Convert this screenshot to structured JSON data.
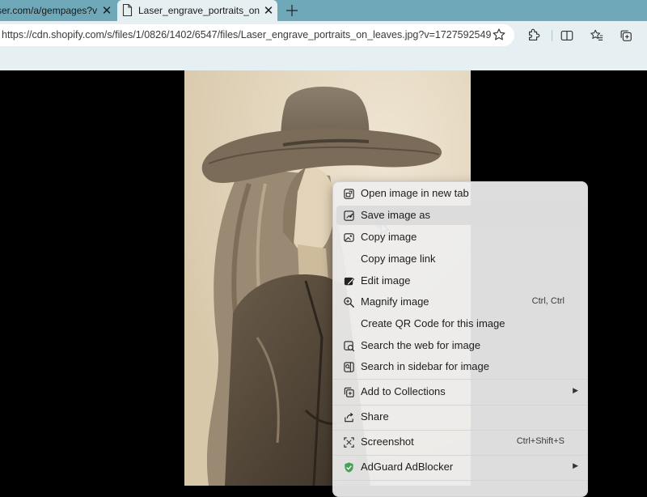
{
  "tabs": [
    {
      "title": "ser.com/a/gempages?versic",
      "active": false
    },
    {
      "title": "Laser_engrave_portraits_on_leave",
      "active": true
    }
  ],
  "address": {
    "url": "https://cdn.shopify.com/s/files/1/0826/1402/6547/files/Laser_engrave_portraits_on_leaves.jpg?v=1727592549"
  },
  "toolbar_icons": [
    "extensions-icon",
    "split-screen-icon",
    "favorites-icon",
    "collections-icon"
  ],
  "context_menu": {
    "items": [
      {
        "label": "Open image in new tab",
        "icon": "open-new-tab-icon",
        "shortcut": "",
        "submenu": false
      },
      {
        "label": "Save image as",
        "icon": "save-image-icon",
        "shortcut": "",
        "submenu": false,
        "hovered": true
      },
      {
        "label": "Copy image",
        "icon": "copy-image-icon",
        "shortcut": "",
        "submenu": false
      },
      {
        "label": "Copy image link",
        "icon": "",
        "shortcut": "",
        "submenu": false
      },
      {
        "label": "Edit image",
        "icon": "edit-image-icon",
        "shortcut": "",
        "submenu": false
      },
      {
        "label": "Magnify image",
        "icon": "magnify-icon",
        "shortcut": "Ctrl, Ctrl",
        "submenu": false
      },
      {
        "label": "Create QR Code for this image",
        "icon": "",
        "shortcut": "",
        "submenu": false
      },
      {
        "label": "Search the web for image",
        "icon": "visual-search-icon",
        "shortcut": "",
        "submenu": false
      },
      {
        "label": "Search in sidebar for image",
        "icon": "sidebar-search-icon",
        "shortcut": "",
        "submenu": false
      },
      {
        "label": "Add to Collections",
        "icon": "collections-icon",
        "shortcut": "",
        "submenu": true
      },
      {
        "label": "Share",
        "icon": "share-icon",
        "shortcut": "",
        "submenu": false
      },
      {
        "label": "Screenshot",
        "icon": "screenshot-icon",
        "shortcut": "Ctrl+Shift+S",
        "submenu": false
      },
      {
        "label": "AdGuard AdBlocker",
        "icon": "adguard-shield-icon",
        "shortcut": "",
        "submenu": true
      }
    ]
  },
  "colors": {
    "tabstrip": "#6fa9b9",
    "toolbar": "#e6eff2",
    "adguard": "#47a05a"
  }
}
